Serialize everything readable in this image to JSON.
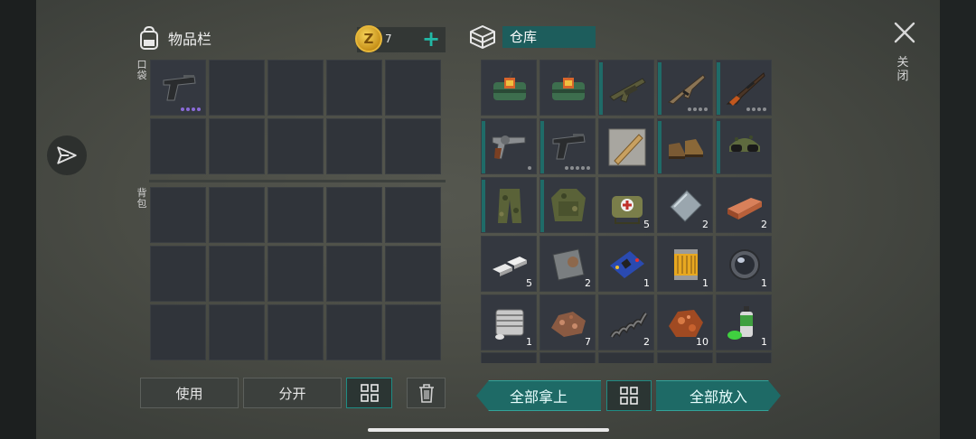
{
  "inventory": {
    "title": "物品栏",
    "pocket_label": "口袋",
    "backpack_label": "背包",
    "currency": {
      "icon": "coin-icon",
      "symbol": "Z",
      "amount": "7",
      "add_symbol": "+"
    },
    "pocket_slots": [
      {
        "icon": "pistol-icon",
        "dots": 4,
        "dot_color": "#8a6bd8"
      },
      {},
      {},
      {},
      {},
      {},
      {},
      {},
      {},
      {}
    ],
    "backpack_slots": 15,
    "buttons": {
      "use": "使用",
      "split": "分开"
    }
  },
  "storage": {
    "title": "仓库",
    "items": [
      {
        "icon": "dynamite-bundle-icon",
        "qty": "",
        "bar": false
      },
      {
        "icon": "dynamite-bundle-icon",
        "qty": "",
        "bar": false
      },
      {
        "icon": "grenade-launcher-rifle-icon",
        "qty": "",
        "bar": true
      },
      {
        "icon": "assault-rifle-icon",
        "qty": "",
        "bar": true,
        "dots": 4
      },
      {
        "icon": "hunting-rifle-icon",
        "qty": "",
        "bar": true,
        "dots": 4
      },
      {
        "icon": "revolver-icon",
        "qty": "",
        "bar": true,
        "dots": 1
      },
      {
        "icon": "pistol-icon",
        "qty": "",
        "bar": true,
        "dots": 5
      },
      {
        "icon": "baseball-bat-blueprint-icon",
        "qty": "",
        "bar": false
      },
      {
        "icon": "boots-icon",
        "qty": "",
        "bar": true
      },
      {
        "icon": "camo-goggles-cap-icon",
        "qty": "",
        "bar": true
      },
      {
        "icon": "camo-pants-icon",
        "qty": "",
        "bar": true
      },
      {
        "icon": "camo-jacket-icon",
        "qty": "",
        "bar": true
      },
      {
        "icon": "medkit-bag-icon",
        "qty": "5",
        "bar": false
      },
      {
        "icon": "steel-plate-icon",
        "qty": "2",
        "bar": false
      },
      {
        "icon": "copper-ingot-icon",
        "qty": "2",
        "bar": false
      },
      {
        "icon": "aluminum-ingot-icon",
        "qty": "5",
        "bar": false
      },
      {
        "icon": "iron-plate-icon",
        "qty": "2",
        "bar": false
      },
      {
        "icon": "circuit-board-icon",
        "qty": "1",
        "bar": false
      },
      {
        "icon": "oil-filter-icon",
        "qty": "1",
        "bar": false
      },
      {
        "icon": "lens-icon",
        "qty": "1",
        "bar": false
      },
      {
        "icon": "engine-cylinder-icon",
        "qty": "1",
        "bar": false
      },
      {
        "icon": "copper-ore-icon",
        "qty": "7",
        "bar": false
      },
      {
        "icon": "spring-icon",
        "qty": "2",
        "bar": false
      },
      {
        "icon": "iron-ore-icon",
        "qty": "10",
        "bar": false
      },
      {
        "icon": "spray-can-icon",
        "qty": "1",
        "bar": false
      }
    ],
    "buttons": {
      "take_all": "全部拿上",
      "put_all": "全部放入"
    }
  },
  "window": {
    "close_label": "关闭"
  },
  "colors": {
    "accent": "#1e6a66",
    "cell": "#30343a",
    "gold": "#e8b83a"
  }
}
